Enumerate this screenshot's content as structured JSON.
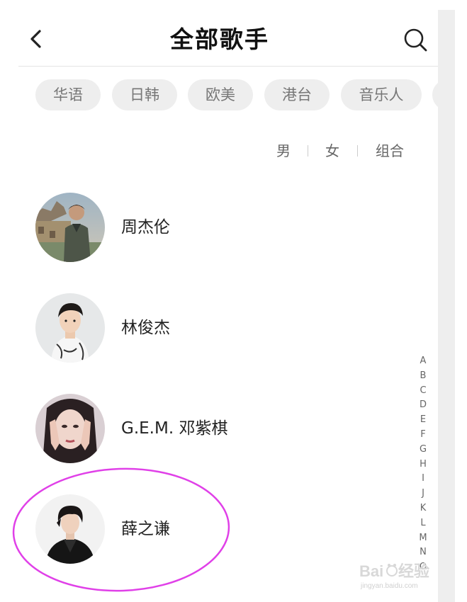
{
  "header": {
    "title": "全部歌手",
    "back_icon": "chevron-left-icon",
    "search_icon": "search-icon"
  },
  "region_tabs": [
    {
      "label": "华语"
    },
    {
      "label": "日韩"
    },
    {
      "label": "欧美"
    },
    {
      "label": "港台"
    },
    {
      "label": "音乐人"
    }
  ],
  "gender_filter": [
    {
      "label": "男"
    },
    {
      "label": "女"
    },
    {
      "label": "组合"
    }
  ],
  "artists": [
    {
      "name": "周杰伦",
      "avatar": "avatar-photo"
    },
    {
      "name": "林俊杰",
      "avatar": "avatar-photo"
    },
    {
      "name": "G.E.M. 邓紫棋",
      "avatar": "avatar-photo"
    },
    {
      "name": "薛之谦",
      "avatar": "avatar-photo",
      "highlighted": true
    }
  ],
  "index_letters": [
    "A",
    "B",
    "C",
    "D",
    "E",
    "F",
    "G",
    "H",
    "I",
    "J",
    "K",
    "L",
    "M",
    "N",
    "O"
  ],
  "annotation": {
    "color": "#e040e8",
    "shape": "ellipse around selected artist"
  },
  "watermark": {
    "brand": "Baidu经验",
    "domain": "jingyan.baidu.com"
  },
  "colors": {
    "chip_bg": "#eeeeee",
    "chip_text": "#777777",
    "title_text": "#111111"
  }
}
